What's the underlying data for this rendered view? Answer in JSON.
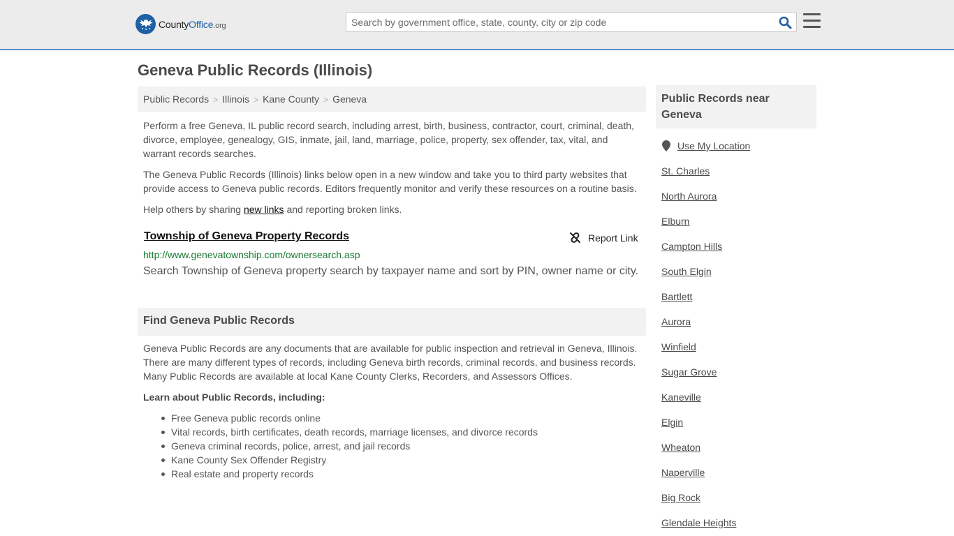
{
  "header": {
    "logo_county": "County",
    "logo_office": "Office",
    "logo_org": ".org",
    "search_placeholder": "Search by government office, state, county, city or zip code",
    "search_icon": "search-icon",
    "menu_icon": "hamburger-menu-icon"
  },
  "page": {
    "title": "Geneva Public Records (Illinois)"
  },
  "breadcrumb": [
    "Public Records",
    "Illinois",
    "Kane County",
    "Geneva"
  ],
  "intro": {
    "p1": "Perform a free Geneva, IL public record search, including arrest, birth, business, contractor, court, criminal, death, divorce, employee, genealogy, GIS, inmate, jail, land, marriage, police, property, sex offender, tax, vital, and warrant records searches.",
    "p2": "The Geneva Public Records (Illinois) links below open in a new window and take you to third party websites that provide access to Geneva public records. Editors frequently monitor and verify these resources on a routine basis.",
    "p3_before": "Help others by sharing ",
    "p3_link": "new links",
    "p3_after": " and reporting broken links."
  },
  "record": {
    "title": "Township of Geneva Property Records",
    "report_label": "Report Link",
    "url": "http://www.genevatownship.com/ownersearch.asp",
    "description": "Search Township of Geneva property search by taxpayer name and sort by PIN, owner name or city."
  },
  "find": {
    "header": "Find Geneva Public Records",
    "text": "Geneva Public Records are any documents that are available for public inspection and retrieval in Geneva, Illinois. There are many different types of records, including Geneva birth records, criminal records, and business records. Many Public Records are available at local Kane County Clerks, Recorders, and Assessors Offices.",
    "learn_title": "Learn about Public Records, including:",
    "items": [
      "Free Geneva public records online",
      "Vital records, birth certificates, death records, marriage licenses, and divorce records",
      "Geneva criminal records, police, arrest, and jail records",
      "Kane County Sex Offender Registry",
      "Real estate and property records"
    ]
  },
  "sidebar": {
    "header": "Public Records near Geneva",
    "use_location": "Use My Location",
    "location_icon": "map-pin-icon",
    "cities": [
      "St. Charles",
      "North Aurora",
      "Elburn",
      "Campton Hills",
      "South Elgin",
      "Bartlett",
      "Aurora",
      "Winfield",
      "Sugar Grove",
      "Kaneville",
      "Elgin",
      "Wheaton",
      "Naperville",
      "Big Rock",
      "Glendale Heights"
    ]
  },
  "colors": {
    "brand_blue": "#1f5fa4",
    "url_green": "#1a7a33",
    "panel_gray": "#f2f2f2",
    "header_gray": "#ececec"
  }
}
